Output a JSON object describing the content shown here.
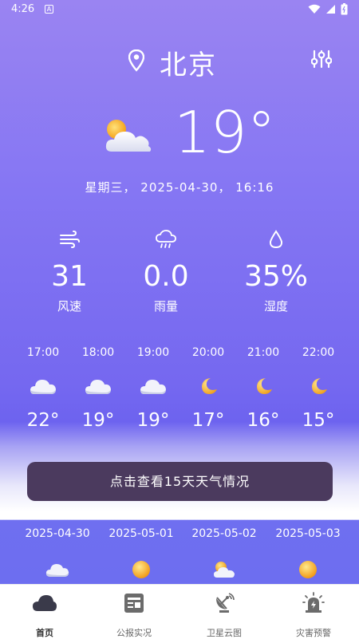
{
  "status_bar": {
    "time": "4:26",
    "notif_letter": "A"
  },
  "header": {
    "city": "北京"
  },
  "current": {
    "temperature": "19°",
    "datetime": "星期三， 2025-04-30， 16:16",
    "icon": "partly-cloudy-icon"
  },
  "stats": [
    {
      "value": "31",
      "label": "风速",
      "icon": "wind-icon"
    },
    {
      "value": "0.0",
      "label": "雨量",
      "icon": "rain-cloud-icon"
    },
    {
      "value": "35%",
      "label": "湿度",
      "icon": "humidity-drop-icon"
    }
  ],
  "hourly": [
    {
      "time": "17:00",
      "temp": "22°",
      "icon": "cloudy-icon"
    },
    {
      "time": "18:00",
      "temp": "19°",
      "icon": "cloudy-icon"
    },
    {
      "time": "19:00",
      "temp": "19°",
      "icon": "cloudy-icon"
    },
    {
      "time": "20:00",
      "temp": "17°",
      "icon": "moon-icon"
    },
    {
      "time": "21:00",
      "temp": "16°",
      "icon": "moon-icon"
    },
    {
      "time": "22:00",
      "temp": "15°",
      "icon": "moon-icon"
    }
  ],
  "cta_label": "点击查看15天天气情况",
  "daily": [
    {
      "date": "2025-04-30",
      "icon": "cloudy-icon"
    },
    {
      "date": "2025-05-01",
      "icon": "sun-icon"
    },
    {
      "date": "2025-05-02",
      "icon": "partly-cloudy-icon"
    },
    {
      "date": "2025-05-03",
      "icon": "sun-icon"
    }
  ],
  "nav": [
    {
      "label": "首页",
      "icon": "cloud-home-icon",
      "active": true
    },
    {
      "label": "公报实况",
      "icon": "bulletin-icon",
      "active": false
    },
    {
      "label": "卫星云图",
      "icon": "satellite-dish-icon",
      "active": false
    },
    {
      "label": "灾害预警",
      "icon": "alarm-warning-icon",
      "active": false
    }
  ],
  "colors": {
    "accent_button": "#4b3a5e",
    "nav_icon": "#6b6b6b",
    "nav_active": "#3a3a4a"
  }
}
